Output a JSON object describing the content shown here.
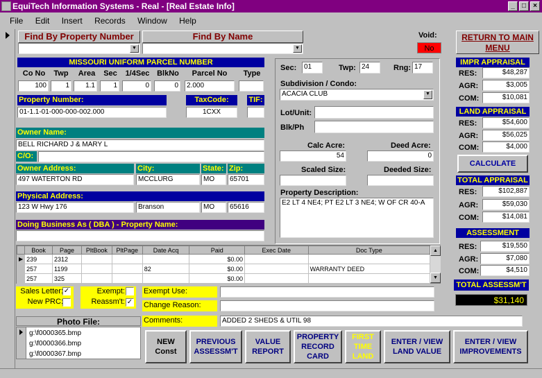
{
  "window": {
    "title": "EquiTech Information Systems - Real - [Real Estate Info]",
    "min": "_",
    "max": "□",
    "close": "×"
  },
  "menu": [
    "File",
    "Edit",
    "Insert",
    "Records",
    "Window",
    "Help"
  ],
  "find": {
    "by_property_number": "Find By Property Number",
    "by_name": "Find By Name"
  },
  "void": {
    "label": "Void:",
    "value": "No"
  },
  "return_main_menu": "RETURN TO MAIN MENU",
  "parcel": {
    "header": "MISSOURI UNIFORM PARCEL NUMBER",
    "columns": [
      "Co No",
      "Twp",
      "Area",
      "Sec",
      "1/4Sec",
      "BlkNo",
      "Parcel No",
      "Type"
    ],
    "values": [
      "100",
      "1",
      "1.1",
      "1",
      "0",
      "0",
      "2.000",
      ""
    ]
  },
  "property_number": {
    "label": "Property Number:",
    "value": "01-1.1-01-000-000-002.000"
  },
  "taxcode": {
    "label": "TaxCode:",
    "value": "1CXX"
  },
  "tif": {
    "label": "TIF:",
    "value": ""
  },
  "owner": {
    "label": "Owner Name:",
    "value": "BELL RICHARD J & MARY L",
    "co_label": "C/O:",
    "co_value": ""
  },
  "owner_address": {
    "label": "Owner Address:",
    "city_label": "City:",
    "state_label": "State:",
    "zip_label": "Zip:",
    "address": "497 WATERTON RD",
    "city": "MCCLURG",
    "state": "MO",
    "zip": "65701"
  },
  "physical_address": {
    "label": "Physical Address:",
    "address": "123 W Hwy 176",
    "city": "Branson",
    "state": "MO",
    "zip": "65616"
  },
  "dba": {
    "label": "Doing Business As ( DBA ) - Property Name:",
    "value": ""
  },
  "location": {
    "sec_label": "Sec:",
    "sec": "01",
    "twp_label": "Twp:",
    "twp": "24",
    "rng_label": "Rng:",
    "rng": "17"
  },
  "subdivision": {
    "label": "Subdivision / Condo:",
    "value": "ACACIA CLUB"
  },
  "lot": {
    "lot_label": "Lot/Unit:",
    "lot": "",
    "blk_label": "Blk/Ph",
    "blk": ""
  },
  "acres": {
    "calc_label": "Calc Acre:",
    "calc": "54",
    "deed_label": "Deed Acre:",
    "deed": "0",
    "scaled_label": "Scaled Size:",
    "scaled": "",
    "deeded_label": "Deeded Size:",
    "deeded": ""
  },
  "description": {
    "label": "Property Description:",
    "value": "E2 LT 4 NE4; PT E2 LT 3 NE4; W OF CR 40-A"
  },
  "impr_appraisal": {
    "header": "IMPR APPRAISAL",
    "res_label": "RES:",
    "res": "$48,287",
    "agr_label": "AGR:",
    "agr": "$3,005",
    "com_label": "COM:",
    "com": "$10,081"
  },
  "land_appraisal": {
    "header": "LAND APPRAISAL",
    "res_label": "RES:",
    "res": "$54,600",
    "agr_label": "AGR:",
    "agr": "$56,025",
    "com_label": "COM:",
    "com": "$4,000"
  },
  "calculate": "CALCULATE",
  "total_appraisal": {
    "header": "TOTAL APPRAISAL",
    "res_label": "RES:",
    "res": "$102,887",
    "agr_label": "AGR:",
    "agr": "$59,030",
    "com_label": "COM:",
    "com": "$14,081"
  },
  "assessment": {
    "header": "ASSESSMENT",
    "res_label": "RES:",
    "res": "$19,550",
    "agr_label": "AGR:",
    "agr": "$7,080",
    "com_label": "COM:",
    "com": "$4,510"
  },
  "total_assessment": {
    "header": "TOTAL ASSESSM'T",
    "value": "$31,140"
  },
  "deeds": {
    "columns": [
      "Book",
      "Page",
      "PltBook",
      "PltPage",
      "Date Acq",
      "Paid",
      "Exec Date",
      "Doc Type"
    ],
    "rows": [
      [
        "239",
        "2312",
        "",
        "",
        "",
        "$0.00",
        "",
        ""
      ],
      [
        "257",
        "1199",
        "",
        "",
        "82",
        "$0.00",
        "",
        "WARRANTY DEED"
      ],
      [
        "257",
        "325",
        "",
        "",
        "",
        "$0.00",
        "",
        ""
      ]
    ]
  },
  "flags": {
    "sales_letter": "Sales Letter:",
    "new_prc": "New PRC:",
    "exempt": "Exempt:",
    "reassmt": "Reassm't:"
  },
  "exempt_use": {
    "label": "Exempt Use:",
    "value": ""
  },
  "change_reason": {
    "label": "Change Reason:",
    "value": ""
  },
  "comments": {
    "label": "Comments:",
    "value": "ADDED 2 SHEDS & UTIL 98"
  },
  "photo": {
    "label": "Photo File:",
    "files": [
      "g:\\f0000365.bmp",
      "g:\\f0000366.bmp",
      "g:\\f0000367.bmp"
    ]
  },
  "buttons": {
    "new_const": "NEW Const",
    "previous_assessmt": "PREVIOUS ASSESSM'T",
    "value_report": "VALUE REPORT",
    "property_record_card": "PROPERTY RECORD CARD",
    "first_time_land": "FIRST TIME LAND",
    "land_value": "ENTER / VIEW LAND VALUE",
    "improvements": "ENTER / VIEW IMPROVEMENTS"
  },
  "colors": {
    "title": "#800080",
    "navy": "#0000a0",
    "teal": "#008080",
    "yellow": "#ffff00",
    "void": "#ff0000"
  }
}
